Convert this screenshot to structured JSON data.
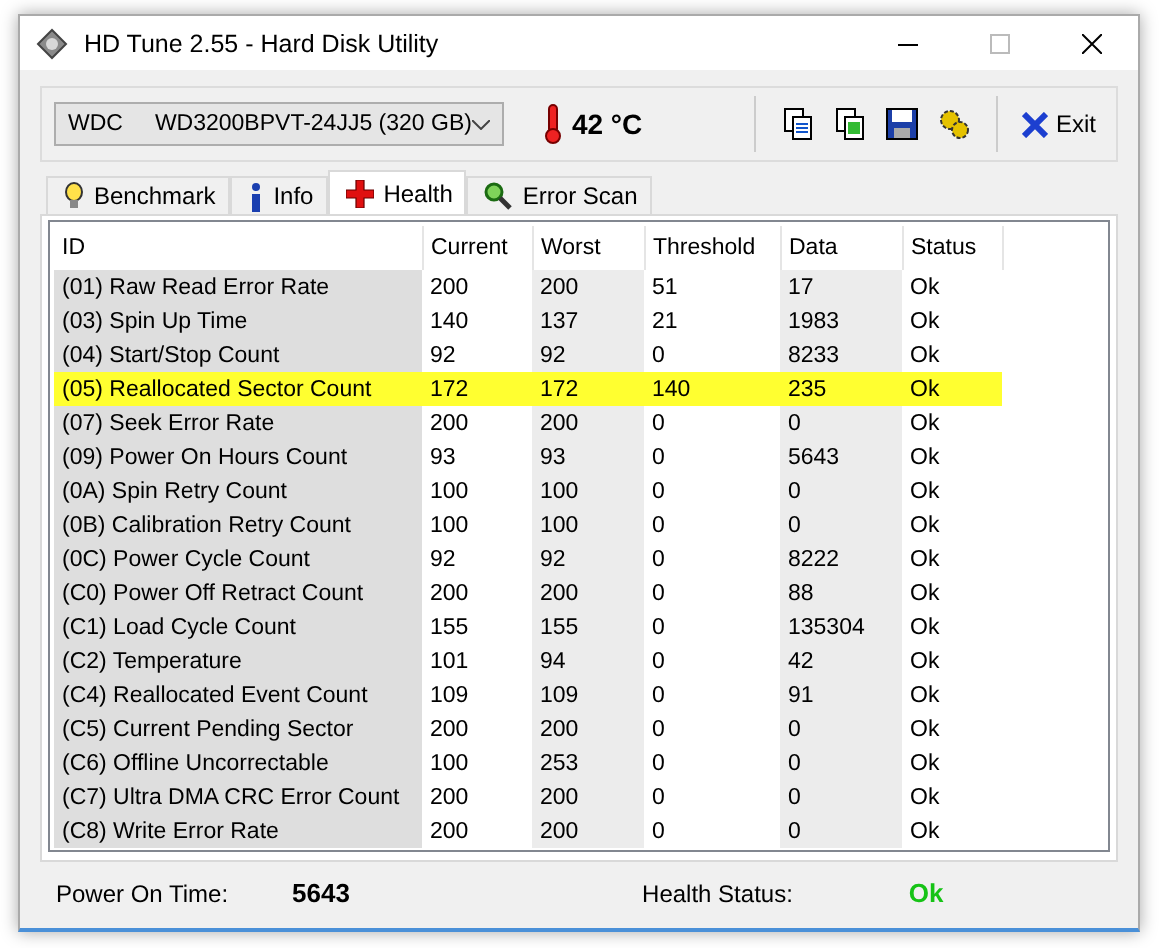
{
  "window": {
    "title": "HD Tune 2.55 - Hard Disk Utility"
  },
  "drive": {
    "value": "WDC     WD3200BPVT-24JJ5 (320 GB)"
  },
  "temperature": "42 °C",
  "toolbar": {
    "exit_label": "Exit"
  },
  "tabs": [
    {
      "label": "Benchmark",
      "selected": false,
      "kind": "bulb"
    },
    {
      "label": "Info",
      "selected": false,
      "kind": "info"
    },
    {
      "label": "Health",
      "selected": true,
      "kind": "cross"
    },
    {
      "label": "Error Scan",
      "selected": false,
      "kind": "magnifier"
    }
  ],
  "table": {
    "columns": [
      "ID",
      "Current",
      "Worst",
      "Threshold",
      "Data",
      "Status"
    ],
    "rows": [
      {
        "cells": [
          "(01) Raw Read Error Rate",
          "200",
          "200",
          "51",
          "17",
          "Ok"
        ],
        "selected": false
      },
      {
        "cells": [
          "(03) Spin Up Time",
          "140",
          "137",
          "21",
          "1983",
          "Ok"
        ],
        "selected": false
      },
      {
        "cells": [
          "(04) Start/Stop Count",
          "92",
          "92",
          "0",
          "8233",
          "Ok"
        ],
        "selected": false
      },
      {
        "cells": [
          "(05) Reallocated Sector Count",
          "172",
          "172",
          "140",
          "235",
          "Ok"
        ],
        "selected": true
      },
      {
        "cells": [
          "(07) Seek Error Rate",
          "200",
          "200",
          "0",
          "0",
          "Ok"
        ],
        "selected": false
      },
      {
        "cells": [
          "(09) Power On Hours Count",
          "93",
          "93",
          "0",
          "5643",
          "Ok"
        ],
        "selected": false
      },
      {
        "cells": [
          "(0A) Spin Retry Count",
          "100",
          "100",
          "0",
          "0",
          "Ok"
        ],
        "selected": false
      },
      {
        "cells": [
          "(0B) Calibration Retry Count",
          "100",
          "100",
          "0",
          "0",
          "Ok"
        ],
        "selected": false
      },
      {
        "cells": [
          "(0C) Power Cycle Count",
          "92",
          "92",
          "0",
          "8222",
          "Ok"
        ],
        "selected": false
      },
      {
        "cells": [
          "(C0) Power Off Retract Count",
          "200",
          "200",
          "0",
          "88",
          "Ok"
        ],
        "selected": false
      },
      {
        "cells": [
          "(C1) Load Cycle Count",
          "155",
          "155",
          "0",
          "135304",
          "Ok"
        ],
        "selected": false
      },
      {
        "cells": [
          "(C2) Temperature",
          "101",
          "94",
          "0",
          "42",
          "Ok"
        ],
        "selected": false
      },
      {
        "cells": [
          "(C4) Reallocated Event Count",
          "109",
          "109",
          "0",
          "91",
          "Ok"
        ],
        "selected": false
      },
      {
        "cells": [
          "(C5) Current Pending Sector",
          "200",
          "200",
          "0",
          "0",
          "Ok"
        ],
        "selected": false
      },
      {
        "cells": [
          "(C6) Offline Uncorrectable",
          "100",
          "253",
          "0",
          "0",
          "Ok"
        ],
        "selected": false
      },
      {
        "cells": [
          "(C7) Ultra DMA CRC Error Count",
          "200",
          "200",
          "0",
          "0",
          "Ok"
        ],
        "selected": false
      },
      {
        "cells": [
          "(C8) Write Error Rate",
          "200",
          "200",
          "0",
          "0",
          "Ok"
        ],
        "selected": false
      }
    ]
  },
  "footer": {
    "power_on_label": "Power On Time:",
    "power_on_value": "5643",
    "health_label": "Health Status:",
    "health_value": "Ok"
  }
}
